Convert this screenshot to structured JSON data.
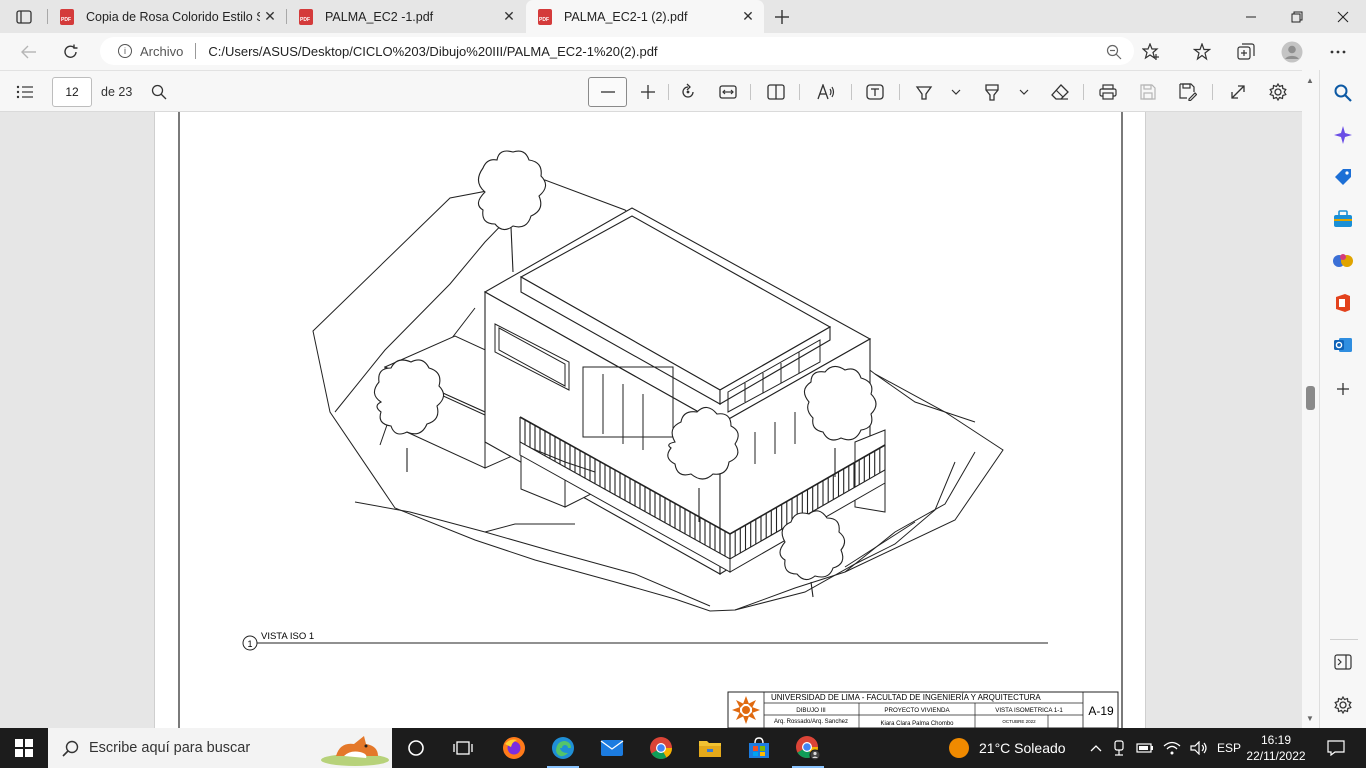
{
  "browser": {
    "tabs": [
      {
        "title": "Copia de Rosa Colorido Estilo Se",
        "active": false
      },
      {
        "title": "PALMA_EC2 -1.pdf",
        "active": false
      },
      {
        "title": "PALMA_EC2-1 (2).pdf",
        "active": true
      }
    ],
    "address": {
      "scheme_label": "Archivo",
      "url": "C:/Users/ASUS/Desktop/CICLO%203/Dibujo%20III/PALMA_EC2-1%20(2).pdf"
    }
  },
  "pdf_toolbar": {
    "current_page": "12",
    "total_pages": "de 23"
  },
  "drawing": {
    "view_number": "1",
    "view_title": "VISTA ISO 1",
    "title_block": {
      "institution": "UNIVERSIDAD DE LIMA - FACULTAD DE INGENIERÍA Y ARQUITECTURA",
      "course": "DIBUJO III",
      "project": "PROYECTO VIVIENDA",
      "sheet_title": "VISTA ISOMETRICA 1-1",
      "professors": "Arq. Rossado/Arq. Sanchez",
      "student": "Kiara Clara Palma Chombo",
      "date": "OCTUBRE 2022",
      "sheet_number": "A-19"
    }
  },
  "taskbar": {
    "search_placeholder": "Escribe aquí para buscar",
    "weather": "21°C  Soleado",
    "language": "ESP",
    "time": "16:19",
    "date": "22/11/2022"
  },
  "colors": {
    "edge_blue": "#0c59a4",
    "pdf_red": "#d43b3b",
    "taskbar": "#1c1c1c"
  }
}
